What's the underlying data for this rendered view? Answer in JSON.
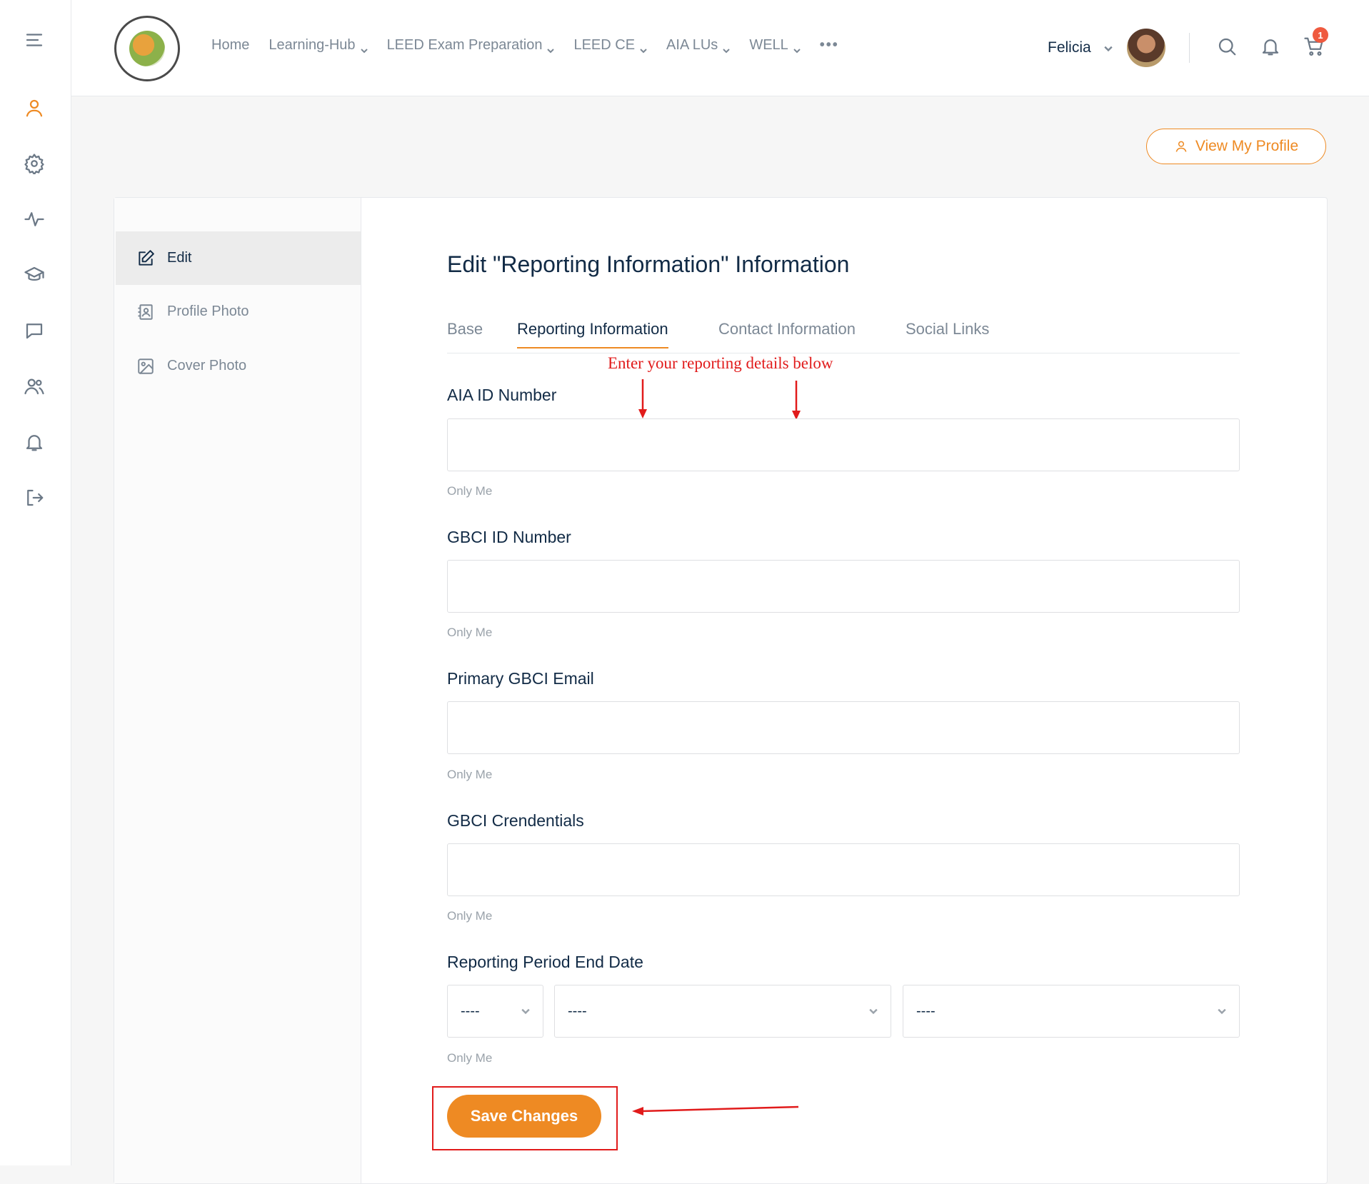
{
  "rail": {
    "items": [
      {
        "icon": "menu-icon"
      },
      {
        "icon": "profile-icon",
        "active": true
      },
      {
        "icon": "gear-icon"
      },
      {
        "icon": "activity-icon"
      },
      {
        "icon": "graduation-cap-icon"
      },
      {
        "icon": "chat-icon"
      },
      {
        "icon": "group-icon"
      },
      {
        "icon": "bell-icon"
      },
      {
        "icon": "logout-icon"
      }
    ]
  },
  "header": {
    "nav": [
      {
        "label": "Home",
        "dropdown": false
      },
      {
        "label": "Learning-Hub",
        "dropdown": true
      },
      {
        "label": "LEED Exam Preparation",
        "dropdown": true
      },
      {
        "label": "LEED CE",
        "dropdown": true
      },
      {
        "label": "AIA LUs",
        "dropdown": true
      },
      {
        "label": "WELL",
        "dropdown": true
      }
    ],
    "more": "•••",
    "user_name": "Felicia",
    "cart_count": "1",
    "icons": [
      "search-icon",
      "bell-icon",
      "cart-icon"
    ]
  },
  "view_profile_label": "View My Profile",
  "sidebar": {
    "items": [
      {
        "label": "Edit",
        "icon": "edit-icon",
        "active": true
      },
      {
        "label": "Profile Photo",
        "icon": "profile-photo-icon",
        "active": false
      },
      {
        "label": "Cover Photo",
        "icon": "image-icon",
        "active": false
      }
    ]
  },
  "main": {
    "title": "Edit \"Reporting Information\" Information",
    "tabs": [
      {
        "label": "Base",
        "active": false
      },
      {
        "label": "Reporting Information",
        "active": true
      },
      {
        "label": "Contact Information",
        "active": false
      },
      {
        "label": "Social Links",
        "active": false
      }
    ],
    "annotation": "Enter your reporting details below",
    "fields": [
      {
        "label": "AIA ID Number",
        "value": "",
        "visibility": "Only Me"
      },
      {
        "label": "GBCI ID Number",
        "value": "",
        "visibility": "Only Me"
      },
      {
        "label": "Primary GBCI Email",
        "value": "",
        "visibility": "Only Me"
      },
      {
        "label": "GBCI Crendentials",
        "value": "",
        "visibility": "Only Me"
      }
    ],
    "date_field": {
      "label": "Reporting Period End Date",
      "selects": [
        "----",
        "----",
        "----"
      ],
      "visibility": "Only Me"
    },
    "save_label": "Save Changes"
  },
  "colors": {
    "accent": "#ee8a23",
    "annotation_red": "#e11b1b",
    "text_dark": "#122b46",
    "text_muted": "#7c8895"
  }
}
